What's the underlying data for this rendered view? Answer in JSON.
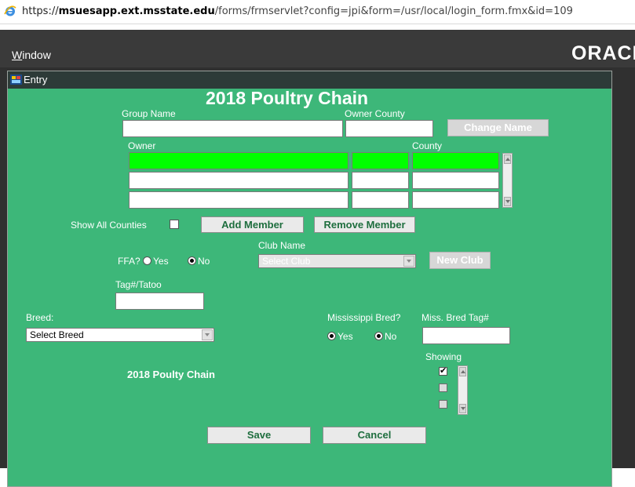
{
  "browser": {
    "url_scheme": "https://",
    "url_host": "msuesapp.ext.msstate.edu",
    "url_rest": "/forms/frmservlet?config=jpi&form=/usr/local/login_form.fmx&id=109"
  },
  "menubar": {
    "window_menu_first": "W",
    "window_menu_rest": "indow",
    "logo_text": "ORACLE"
  },
  "window": {
    "title": "Entry"
  },
  "form": {
    "heading": "2018 Poultry Chain",
    "group_name_label": "Group Name",
    "group_name_value": "",
    "owner_county_label": "Owner County",
    "owner_county_value": "",
    "change_name_button": "Change Name",
    "owner_label": "Owner",
    "county_label": "County",
    "show_all_counties_label": "Show All Counties",
    "add_member_button": "Add Member",
    "remove_member_button": "Remove Member",
    "club_name_label": "Club Name",
    "club_select_value": "Select Club",
    "ffa_label": "FFA?",
    "ffa_yes": "Yes",
    "ffa_no": "No",
    "new_club_button": "New Club",
    "tag_label": "Tag#/Tatoo",
    "tag_value": "",
    "breed_label": "Breed:",
    "breed_select_value": "Select Breed",
    "ms_bred_label": "Mississippi Bred?",
    "ms_bred_yes": "Yes",
    "ms_bred_no": "No",
    "ms_bred_tag_label": "Miss. Bred Tag#",
    "ms_bred_tag_value": "",
    "showing_label": "Showing",
    "chain_caption": "2018 Poulty Chain",
    "save_button": "Save",
    "cancel_button": "Cancel"
  },
  "colors": {
    "form_bg": "#3db779",
    "selected_row": "#00ff00",
    "button_text": "#1e6e3e",
    "title_bar": "#2d3b38",
    "app_bg": "#303030"
  },
  "icons": {
    "browser": "ie-icon",
    "window": "form-window-icon"
  }
}
